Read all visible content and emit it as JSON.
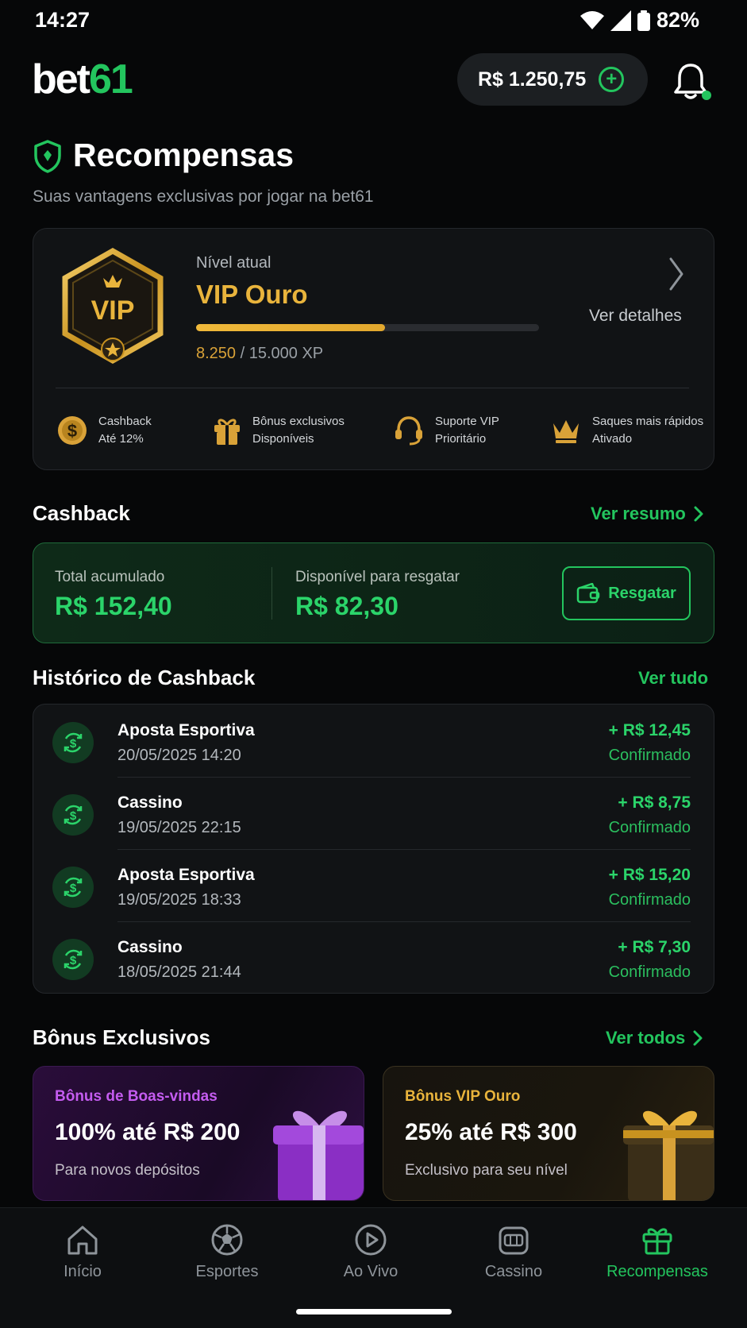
{
  "status_bar": {
    "time": "14:27",
    "battery": "82%"
  },
  "header": {
    "logo_text": "bet",
    "logo_number": "61",
    "balance": "R$ 1.250,75"
  },
  "page": {
    "title": "Recompensas",
    "subtitle": "Suas vantagens exclusivas por jogar na bet61"
  },
  "vip": {
    "badge_text": "VIP",
    "level_label": "Nível atual",
    "level_name": "VIP Ouro",
    "progress_fraction": 0.55,
    "xp_current": "8.250",
    "xp_total": " / 15.000 XP",
    "details_label": "Ver detalhes",
    "benefits": [
      {
        "icon": "coin-icon",
        "title": "Cashback",
        "value": "Até 12%"
      },
      {
        "icon": "gift-icon",
        "title": "Bônus exclusivos",
        "value": "Disponíveis"
      },
      {
        "icon": "headset-icon",
        "title": "Suporte VIP",
        "value": "Prioritário"
      },
      {
        "icon": "crown-icon",
        "title": "Saques mais rápidos",
        "value": "Ativado"
      }
    ]
  },
  "cashback": {
    "section_title": "Cashback",
    "summary_link": "Ver resumo",
    "total_label": "Total acumulado",
    "total_value": "R$ 152,40",
    "available_label": "Disponível para resgatar",
    "available_value": "R$ 82,30",
    "redeem_label": "Resgatar"
  },
  "history": {
    "section_title": "Histórico de Cashback",
    "all_link": "Ver tudo",
    "rows": [
      {
        "name": "Aposta Esportiva",
        "date": "20/05/2025 14:20",
        "amount": "+ R$ 12,45",
        "status": "Confirmado"
      },
      {
        "name": "Cassino",
        "date": "19/05/2025 22:15",
        "amount": "+ R$ 8,75",
        "status": "Confirmado"
      },
      {
        "name": "Aposta Esportiva",
        "date": "19/05/2025 18:33",
        "amount": "+ R$ 15,20",
        "status": "Confirmado"
      },
      {
        "name": "Cassino",
        "date": "18/05/2025 21:44",
        "amount": "+ R$ 7,30",
        "status": "Confirmado"
      }
    ]
  },
  "bonuses": {
    "section_title": "Bônus Exclusivos",
    "all_link": "Ver todos",
    "cards": [
      {
        "tag": "Bônus de Boas-vindas",
        "headline": "100% até R$ 200",
        "subtitle": "Para novos depósitos",
        "tag_color": "#c45cf0"
      },
      {
        "tag": "Bônus VIP Ouro",
        "headline": "25% até R$ 300",
        "subtitle": "Exclusivo para seu nível",
        "tag_color": "#e9b43c"
      }
    ]
  },
  "nav": {
    "items": [
      {
        "label": "Início",
        "icon": "home-icon"
      },
      {
        "label": "Esportes",
        "icon": "soccer-ball-icon"
      },
      {
        "label": "Ao Vivo",
        "icon": "play-icon"
      },
      {
        "label": "Cassino",
        "icon": "slot-machine-icon"
      },
      {
        "label": "Recompensas",
        "icon": "gift-icon",
        "active": true
      }
    ]
  },
  "colors": {
    "accent": "#23c55e",
    "gold": "#e9b43c",
    "background": "#060708"
  }
}
